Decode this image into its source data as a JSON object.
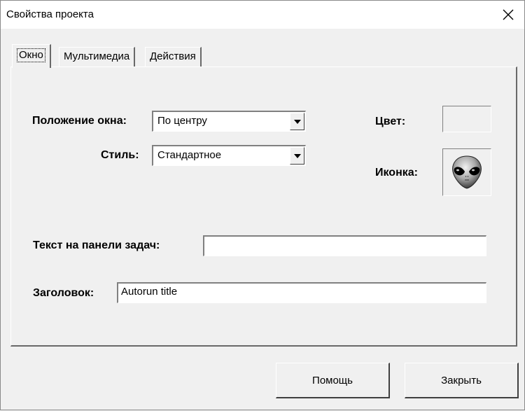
{
  "window": {
    "title": "Свойства проекта",
    "close_icon": "close-icon"
  },
  "tabs": [
    {
      "label": "Окно",
      "active": true
    },
    {
      "label": "Мультимедиа",
      "active": false
    },
    {
      "label": "Действия",
      "active": false
    }
  ],
  "form": {
    "window_position_label": "Положение окна:",
    "window_position_value": "По центру",
    "style_label": "Стиль:",
    "style_value": "Стандартное",
    "color_label": "Цвет:",
    "icon_label": "Иконка:",
    "icon_image": "alien-icon",
    "taskbar_text_label": "Текст на панели задач:",
    "taskbar_text_value": "",
    "caption_label": "Заголовок:",
    "caption_value": "Autorun title"
  },
  "buttons": {
    "help_label": "Помощь",
    "close_label": "Закрыть"
  }
}
